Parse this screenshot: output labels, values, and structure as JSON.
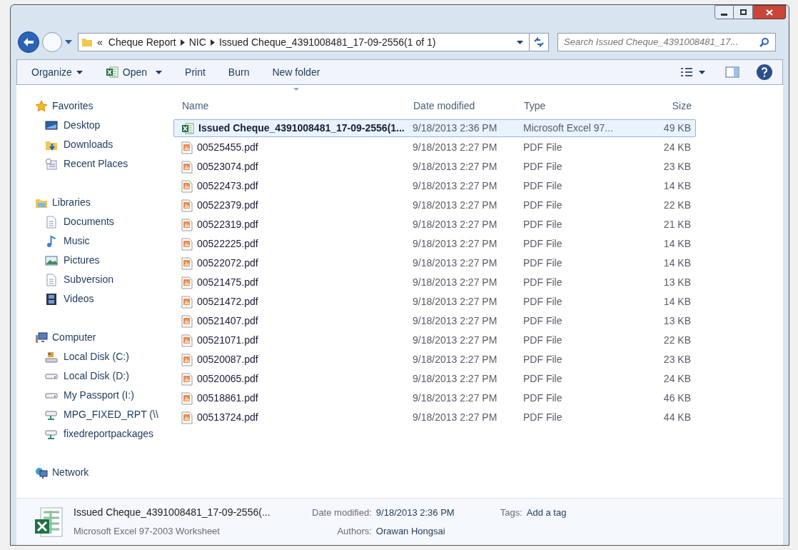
{
  "address_bar": {
    "overflow": "«",
    "crumbs": [
      "Cheque Report",
      "NIC",
      "Issued Cheque_4391008481_17-09-2556(1 of 1)"
    ]
  },
  "search": {
    "placeholder": "Search Issued Cheque_4391008481_17..."
  },
  "toolbar": [
    {
      "label": "Organize",
      "kind": "menu"
    },
    {
      "label": "Open",
      "kind": "excel-menu"
    },
    {
      "label": "Print",
      "kind": "plain"
    },
    {
      "label": "Burn",
      "kind": "plain"
    },
    {
      "label": "New folder",
      "kind": "plain"
    }
  ],
  "sidebar": [
    {
      "label": "Favorites",
      "kind": "star",
      "children": [
        {
          "label": "Desktop",
          "kind": "desktop"
        },
        {
          "label": "Downloads",
          "kind": "downloads"
        },
        {
          "label": "Recent Places",
          "kind": "recent"
        }
      ]
    },
    {
      "label": "Libraries",
      "kind": "library",
      "children": [
        {
          "label": "Documents",
          "kind": "doc"
        },
        {
          "label": "Music",
          "kind": "music"
        },
        {
          "label": "Pictures",
          "kind": "pictures"
        },
        {
          "label": "Subversion",
          "kind": "doc"
        },
        {
          "label": "Videos",
          "kind": "video"
        }
      ]
    },
    {
      "label": "Computer",
      "kind": "computer",
      "children": [
        {
          "label": "Local Disk (C:)",
          "kind": "sysdisk"
        },
        {
          "label": "Local Disk (D:)",
          "kind": "disk"
        },
        {
          "label": "My Passport (I:)",
          "kind": "disk"
        },
        {
          "label": "MPG_FIXED_RPT (\\\\",
          "kind": "netdrive"
        },
        {
          "label": "fixedreportpackages",
          "kind": "netdrive"
        }
      ]
    },
    {
      "label": "Network",
      "kind": "network"
    }
  ],
  "table": {
    "columns": [
      "Name",
      "Date modified",
      "Type",
      "Size"
    ],
    "rows": [
      {
        "kind": "excel",
        "selected": true,
        "cells": [
          "Issued Cheque_4391008481_17-09-2556(1...",
          "9/18/2013 2:36 PM",
          "Microsoft Excel 97...",
          "49 KB"
        ]
      },
      {
        "kind": "pdf",
        "selected": false,
        "cells": [
          "00525455.pdf",
          "9/18/2013 2:27 PM",
          "PDF File",
          "24 KB"
        ]
      },
      {
        "kind": "pdf",
        "selected": false,
        "cells": [
          "00523074.pdf",
          "9/18/2013 2:27 PM",
          "PDF File",
          "23 KB"
        ]
      },
      {
        "kind": "pdf",
        "selected": false,
        "cells": [
          "00522473.pdf",
          "9/18/2013 2:27 PM",
          "PDF File",
          "14 KB"
        ]
      },
      {
        "kind": "pdf",
        "selected": false,
        "cells": [
          "00522379.pdf",
          "9/18/2013 2:27 PM",
          "PDF File",
          "22 KB"
        ]
      },
      {
        "kind": "pdf",
        "selected": false,
        "cells": [
          "00522319.pdf",
          "9/18/2013 2:27 PM",
          "PDF File",
          "21 KB"
        ]
      },
      {
        "kind": "pdf",
        "selected": false,
        "cells": [
          "00522225.pdf",
          "9/18/2013 2:27 PM",
          "PDF File",
          "14 KB"
        ]
      },
      {
        "kind": "pdf",
        "selected": false,
        "cells": [
          "00522072.pdf",
          "9/18/2013 2:27 PM",
          "PDF File",
          "14 KB"
        ]
      },
      {
        "kind": "pdf",
        "selected": false,
        "cells": [
          "00521475.pdf",
          "9/18/2013 2:27 PM",
          "PDF File",
          "13 KB"
        ]
      },
      {
        "kind": "pdf",
        "selected": false,
        "cells": [
          "00521472.pdf",
          "9/18/2013 2:27 PM",
          "PDF File",
          "14 KB"
        ]
      },
      {
        "kind": "pdf",
        "selected": false,
        "cells": [
          "00521407.pdf",
          "9/18/2013 2:27 PM",
          "PDF File",
          "13 KB"
        ]
      },
      {
        "kind": "pdf",
        "selected": false,
        "cells": [
          "00521071.pdf",
          "9/18/2013 2:27 PM",
          "PDF File",
          "22 KB"
        ]
      },
      {
        "kind": "pdf",
        "selected": false,
        "cells": [
          "00520087.pdf",
          "9/18/2013 2:27 PM",
          "PDF File",
          "23 KB"
        ]
      },
      {
        "kind": "pdf",
        "selected": false,
        "cells": [
          "00520065.pdf",
          "9/18/2013 2:27 PM",
          "PDF File",
          "24 KB"
        ]
      },
      {
        "kind": "pdf",
        "selected": false,
        "cells": [
          "00518861.pdf",
          "9/18/2013 2:27 PM",
          "PDF File",
          "46 KB"
        ]
      },
      {
        "kind": "pdf",
        "selected": false,
        "cells": [
          "00513724.pdf",
          "9/18/2013 2:27 PM",
          "PDF File",
          "44 KB"
        ]
      }
    ]
  },
  "details": {
    "name": "Issued Cheque_4391008481_17-09-2556(...",
    "type": "Microsoft Excel 97-2003 Worksheet",
    "groups": [
      [
        {
          "label": "Date modified:",
          "value": "9/18/2013 2:36 PM"
        },
        {
          "label": "Authors:",
          "value": "Orawan Hongsai"
        }
      ],
      [
        {
          "label": "Tags:",
          "value": "Add a tag"
        }
      ]
    ]
  }
}
